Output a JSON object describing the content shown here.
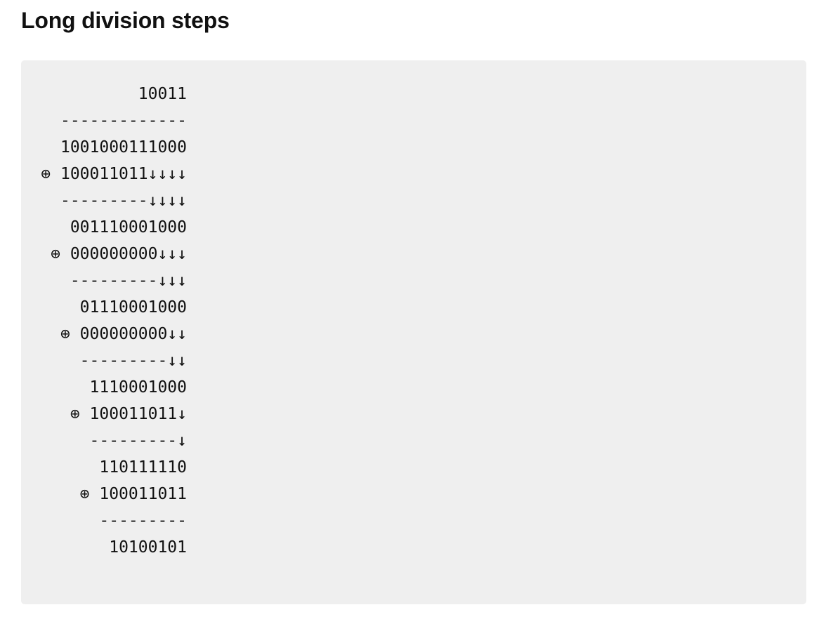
{
  "heading": "Long division steps",
  "lines": [
    "10011",
    "-------------",
    "1001000111000",
    "⊕ 100011011↓↓↓↓",
    "---------↓↓↓↓",
    "001110001000",
    "⊕ 000000000↓↓↓",
    "---------↓↓↓",
    "01110001000",
    "⊕ 000000000↓↓",
    "---------↓↓",
    "1110001000",
    "⊕ 100011011↓",
    "---------↓",
    "110111110",
    "⊕ 100011011",
    "---------",
    "10100101"
  ]
}
